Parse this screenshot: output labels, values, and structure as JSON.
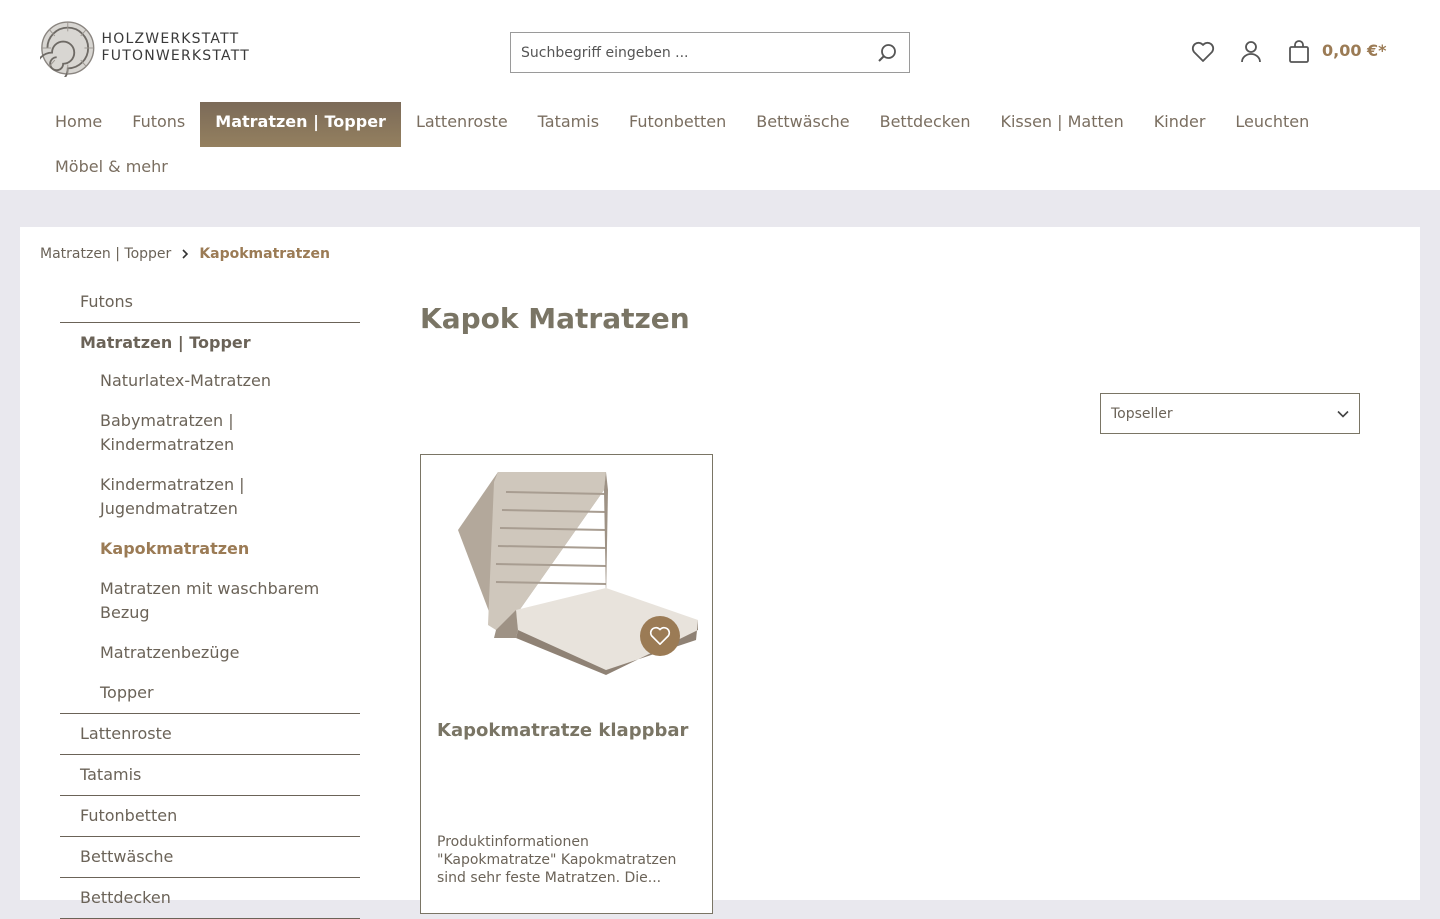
{
  "header": {
    "logo_line1": "HOLZWERKSTATT",
    "logo_line2": "FUTONWERKSTATT",
    "search_placeholder": "Suchbegriff eingeben ...",
    "cart_total": "0,00 €*"
  },
  "mainnav": {
    "row1": [
      "Home",
      "Futons",
      "Matratzen | Topper",
      "Lattenroste",
      "Tatamis",
      "Futonbetten",
      "Bettwäsche",
      "Bettdecken",
      "Kissen | Matten",
      "Kinder",
      "Leuchten"
    ],
    "row2": [
      "Möbel & mehr"
    ],
    "active": "Matratzen | Topper"
  },
  "breadcrumb": {
    "parent": "Matratzen | Topper",
    "current": "Kapokmatratzen"
  },
  "sidebar": {
    "futons": "Futons",
    "matratzen": "Matratzen | Topper",
    "sub": [
      "Naturlatex-Matratzen",
      "Babymatratzen | Kindermatratzen",
      "Kindermatratzen | Jugendmatratzen",
      "Kapokmatratzen",
      "Matratzen mit waschbarem Bezug",
      "Matratzenbezüge",
      "Topper"
    ],
    "rest": [
      "Lattenroste",
      "Tatamis",
      "Futonbetten",
      "Bettwäsche",
      "Bettdecken"
    ]
  },
  "main": {
    "title": "Kapok Matratzen",
    "sort_value": "Topseller"
  },
  "product": {
    "name": "Kapokmatratze klappbar",
    "description": "Produktinformationen \"Kapokmatratze\" Kapokmatratzen sind sehr feste Matratzen.  Die..."
  },
  "colors": {
    "accent": "#9b7b55",
    "text": "#6b6358",
    "background": "#e9e8ee"
  }
}
